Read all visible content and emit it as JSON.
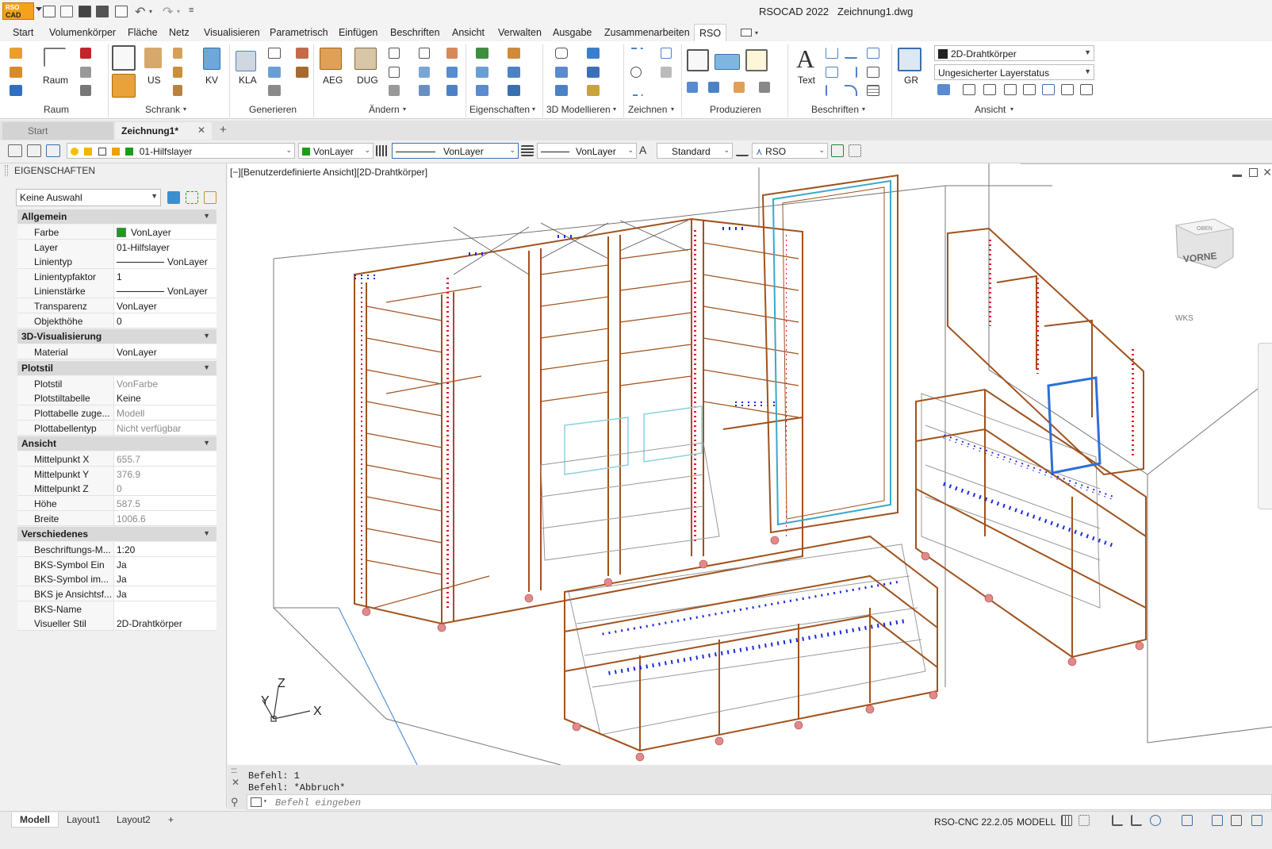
{
  "app": {
    "logo_line1": "RSO",
    "logo_line2": "CAD",
    "product": "RSOCAD 2022",
    "filename": "Zeichnung1.dwg"
  },
  "ribbon_tabs": [
    "Start",
    "Volumenkörper",
    "Fläche",
    "Netz",
    "Visualisieren",
    "Parametrisch",
    "Einfügen",
    "Beschriften",
    "Ansicht",
    "Verwalten",
    "Ausgabe",
    "Zusammenarbeiten",
    "RSO"
  ],
  "active_ribbon_tab": "RSO",
  "ribbon": {
    "panels": [
      "Raum",
      "Schrank",
      "Generieren",
      "Ändern",
      "Eigenschaften",
      "3D Modellieren",
      "Zeichnen",
      "Produzieren",
      "Beschriften",
      "Ansicht"
    ],
    "tools": {
      "raum": "Raum",
      "us": "US",
      "kv": "KV",
      "kla": "KLA",
      "aeg": "AEG",
      "dug": "DUG",
      "text": "Text",
      "gr": "GR"
    },
    "visual_style_value": "2D-Drahtkörper",
    "layer_state_value": "Ungesicherter Layerstatus"
  },
  "doc_tabs": {
    "start": "Start",
    "active": "Zeichnung1*",
    "close": "✕",
    "add": "+"
  },
  "property_bar": {
    "layer": "01-Hilfslayer",
    "color": "VonLayer",
    "linetype": "VonLayer",
    "lineweight": "VonLayer",
    "textstyle": "Standard",
    "dimstyle": "RSO",
    "color_swatch": "#1a9e1a"
  },
  "palette": {
    "title": "EIGENSCHAFTEN",
    "selection": "Keine Auswahl",
    "sections": [
      {
        "title": "Allgemein",
        "rows": [
          {
            "key": "Farbe",
            "value": "VonLayer",
            "swatch": "#1a9e1a"
          },
          {
            "key": "Layer",
            "value": "01-Hilfslayer"
          },
          {
            "key": "Linientyp",
            "value": "VonLayer",
            "line": true
          },
          {
            "key": "Linientypfaktor",
            "value": "1"
          },
          {
            "key": "Linienstärke",
            "value": "VonLayer",
            "line": true
          },
          {
            "key": "Transparenz",
            "value": "VonLayer"
          },
          {
            "key": "Objekthöhe",
            "value": "0"
          }
        ]
      },
      {
        "title": "3D-Visualisierung",
        "rows": [
          {
            "key": "Material",
            "value": "VonLayer"
          }
        ]
      },
      {
        "title": "Plotstil",
        "rows": [
          {
            "key": "Plotstil",
            "value": "VonFarbe",
            "dim": true
          },
          {
            "key": "Plotstiltabelle",
            "value": "Keine"
          },
          {
            "key": "Plottabelle zuge...",
            "value": "Modell",
            "dim": true
          },
          {
            "key": "Plottabellentyp",
            "value": "Nicht verfügbar",
            "dim": true
          }
        ]
      },
      {
        "title": "Ansicht",
        "rows": [
          {
            "key": "Mittelpunkt X",
            "value": "655.7",
            "dim": true
          },
          {
            "key": "Mittelpunkt Y",
            "value": "376.9",
            "dim": true
          },
          {
            "key": "Mittelpunkt Z",
            "value": "0",
            "dim": true
          },
          {
            "key": "Höhe",
            "value": "587.5",
            "dim": true
          },
          {
            "key": "Breite",
            "value": "1006.6",
            "dim": true
          }
        ]
      },
      {
        "title": "Verschiedenes",
        "rows": [
          {
            "key": "Beschriftungs-M...",
            "value": "1:20"
          },
          {
            "key": "BKS-Symbol Ein",
            "value": "Ja"
          },
          {
            "key": "BKS-Symbol im...",
            "value": "Ja"
          },
          {
            "key": "BKS je Ansichtsf...",
            "value": "Ja"
          },
          {
            "key": "BKS-Name",
            "value": ""
          },
          {
            "key": "Visueller Stil",
            "value": "2D-Drahtkörper"
          }
        ]
      }
    ]
  },
  "viewport": {
    "label": "[−][Benutzerdefinierte Ansicht][2D-Drahtkörper]",
    "viewcube_face": "VORNE",
    "viewcube_top": "OBEN",
    "wcs_label": "WKS",
    "axis_x": "X",
    "axis_y": "Y",
    "axis_z": "Z"
  },
  "command": {
    "history": [
      "Befehl: 1",
      "Befehl: *Abbruch*"
    ],
    "placeholder": "Befehl eingeben"
  },
  "layout_tabs": [
    "Modell",
    "Layout1",
    "Layout2"
  ],
  "layout_add": "+",
  "status": {
    "version": "RSO-CNC 22.2.05",
    "space": "MODELL"
  }
}
